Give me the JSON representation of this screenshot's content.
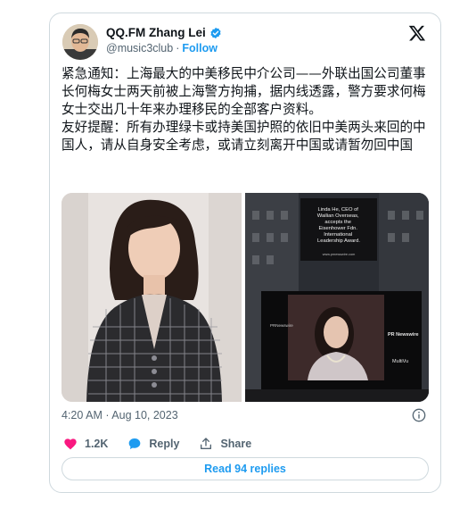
{
  "author": {
    "display_name": "QQ.FM Zhang Lei",
    "handle": "@music3club",
    "separator": "·",
    "follow_label": "Follow",
    "verified_color": "#1d9bf0"
  },
  "tweet": {
    "paragraphs": [
      "紧急通知：上海最大的中美移民中介公司——外联出国公司董事长何梅女士两天前被上海警方拘捕，据内线透露，警方要求何梅女士交出几十年来办理移民的全部客户资料。",
      "友好提醒：所有办理绿卡或持美国护照的依旧中美两头来回的中国人，请从自身安全考虑，或请立刻离开中国或请暂勿回中国"
    ]
  },
  "media": {
    "billboard_text": "Linda He, CEO of Wailian Overseas, accepts the Eisenhower Fdn. International Leadership Award.",
    "billboard_url": "www.prnewswire.com",
    "sign_prn": "PR Newswire",
    "sign_multivu": "MultiVu",
    "sign_left": "PRNewswire"
  },
  "meta": {
    "timestamp": "4:20 AM · Aug 10, 2023"
  },
  "actions": {
    "like_count": "1.2K",
    "reply_label": "Reply",
    "share_label": "Share"
  },
  "read_replies_label": "Read 94 replies",
  "colors": {
    "accent": "#1d9bf0",
    "like": "#f91880",
    "border": "#cfd9de",
    "muted": "#536471"
  }
}
